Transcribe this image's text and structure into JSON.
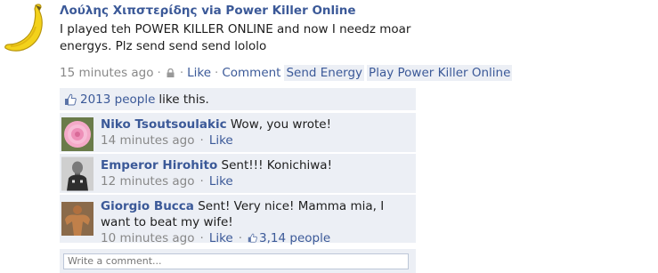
{
  "post": {
    "author": "Λούλης Χιπστερίδης via Power Killer Online",
    "message": "I played teh POWER KILLER ONLINE and now I needz moar energys. Plz send send send lololo",
    "time": "15 minutes ago",
    "like_label": "Like",
    "comment_label": "Comment",
    "send_energy_label": "Send Energy",
    "play_label": "Play Power Killer Online"
  },
  "likes": {
    "count": "2013 people",
    "suffix": "like this."
  },
  "comments": [
    {
      "name": "Niko Tsoutsoulakic",
      "text": "Wow, you wrote!",
      "time": "14 minutes ago",
      "like_label": "Like"
    },
    {
      "name": "Emperor Hirohito",
      "text": "Sent!!! Konichiwa!",
      "time": "12 minutes ago",
      "like_label": "Like"
    },
    {
      "name": "Giorgio Bucca",
      "text": "Sent! Very nice! Mamma mia, I want to beat my wife!",
      "time": "10 minutes ago",
      "like_label": "Like",
      "likes": "3,14 people"
    }
  ],
  "write_comment": {
    "placeholder": "Write a comment..."
  },
  "colors": {
    "link": "#3b5998",
    "panel": "#eceff5",
    "meta": "#888888"
  }
}
